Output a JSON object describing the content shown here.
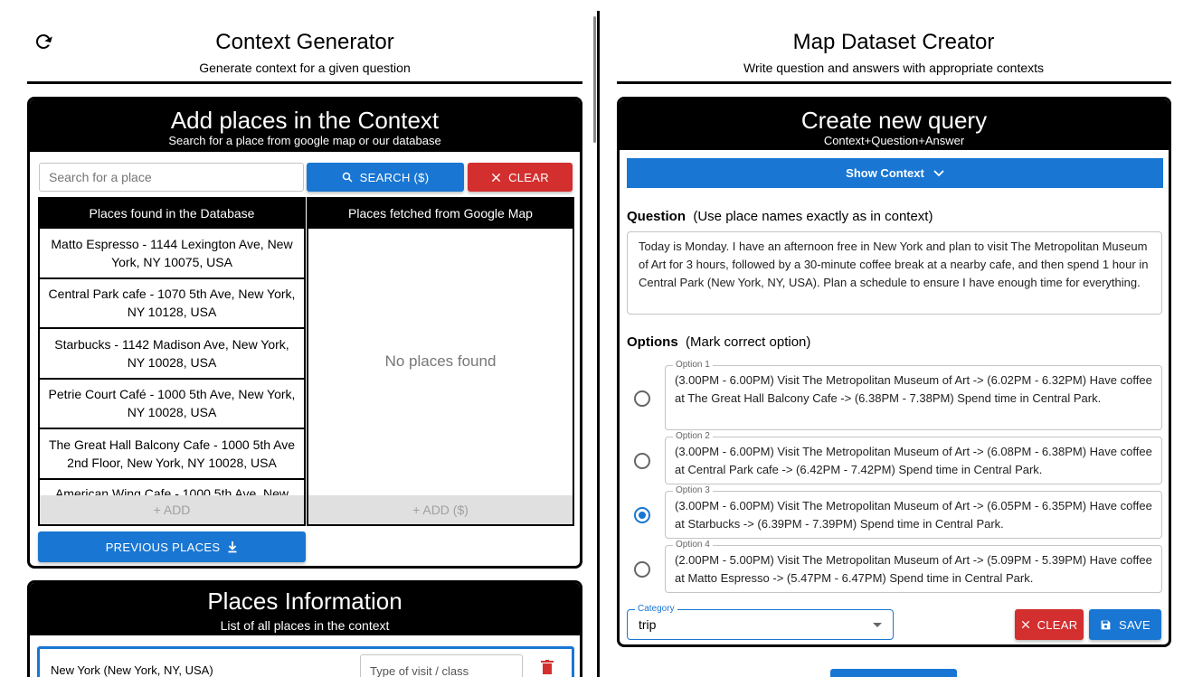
{
  "left": {
    "title": "Context Generator",
    "subtitle": "Generate context for a given question",
    "add_places": {
      "title": "Add places in the Context",
      "subtitle": "Search for a place from google map or our database",
      "search_placeholder": "Search for a place",
      "search_label": "SEARCH ($)",
      "clear_label": "CLEAR",
      "db_header": "Places found in the Database",
      "db_places": [
        "Matto Espresso - 1144 Lexington Ave, New York, NY 10075, USA",
        "Central Park cafe - 1070 5th Ave, New York, NY 10128, USA",
        "Starbucks - 1142 Madison Ave, New York, NY 10028, USA",
        "Petrie Court Café - 1000 5th Ave, New York, NY 10028, USA",
        "The Great Hall Balcony Cafe - 1000 5th Ave 2nd Floor, New York, NY 10028, USA",
        "American Wing Cafe - 1000 5th Ave, New"
      ],
      "db_add": "+ ADD",
      "google_header": "Places fetched from Google Map",
      "google_empty": "No places found",
      "google_add": "+ ADD ($)",
      "previous_label": "PREVIOUS PLACES"
    },
    "places_info": {
      "title": "Places Information",
      "subtitle": "List of all places in the context",
      "first_item_partial": "New York (New York, NY, USA)",
      "field_placeholder_partial": "Type of visit / class"
    }
  },
  "right": {
    "title": "Map Dataset Creator",
    "subtitle": "Write question and answers with appropriate contexts",
    "query": {
      "title": "Create new query",
      "subtitle": "Context+Question+Answer",
      "show_context": "Show Context",
      "question_label": "Question",
      "question_hint": "(Use place names exactly as in context)",
      "question_text": "Today is Monday. I have an afternoon free in New York and plan to visit The Metropolitan Museum of Art for 3 hours, followed by a 30-minute coffee break at a nearby cafe, and then spend 1 hour in Central Park (New York, NY, USA). Plan a schedule to ensure I have enough time for everything.",
      "options_label": "Options",
      "options_hint": "(Mark correct option)",
      "options": [
        {
          "legend": "Option 1",
          "text": "(3.00PM - 6.00PM) Visit The Metropolitan Museum of Art -> (6.02PM - 6.32PM) Have coffee at The Great Hall Balcony Cafe -> (6.38PM - 7.38PM) Spend time in Central Park.",
          "selected": false
        },
        {
          "legend": "Option 2",
          "text": "(3.00PM - 6.00PM) Visit The Metropolitan Museum of Art -> (6.08PM - 6.38PM) Have coffee at Central Park cafe -> (6.42PM - 7.42PM) Spend time in Central Park.",
          "selected": false
        },
        {
          "legend": "Option 3",
          "text": "(3.00PM - 6.00PM) Visit The Metropolitan Museum of Art -> (6.05PM - 6.35PM) Have coffee at Starbucks -> (6.39PM - 7.39PM) Spend time in Central Park.",
          "selected": true
        },
        {
          "legend": "Option 4",
          "text": "(2.00PM - 5.00PM) Visit The Metropolitan Museum of Art -> (5.09PM - 5.39PM) Have coffee at Matto Espresso -> (5.47PM - 6.47PM) Spend time in Central Park.",
          "selected": false
        }
      ],
      "category_legend": "Category",
      "category_value": "trip",
      "clear_label": "CLEAR",
      "save_label": "SAVE"
    }
  },
  "colors": {
    "primary": "#1976d2",
    "danger": "#d32f2f",
    "header_bg": "#000000"
  }
}
